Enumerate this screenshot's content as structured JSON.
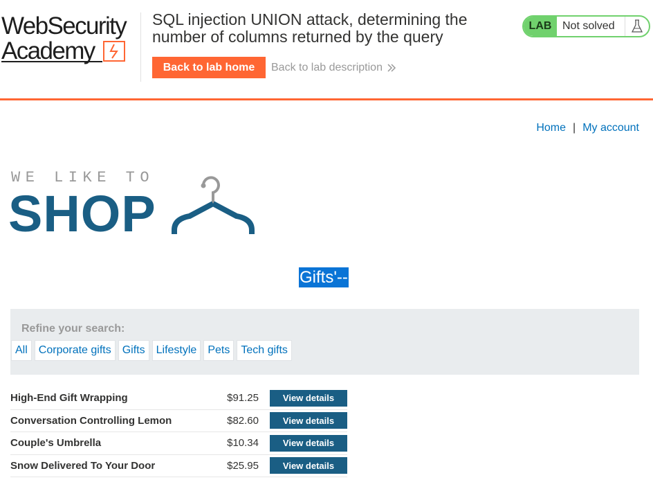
{
  "academy": {
    "logo_line1": "WebSecurity",
    "logo_line2": "Academy",
    "lab_title": "SQL injection UNION attack, determining the number of columns returned by the query",
    "back_home_label": "Back to lab home",
    "back_desc_label": "Back to lab description",
    "back_desc_icon": "double-chevron-right-icon",
    "status_badge": "LAB",
    "status_text": "Not solved",
    "status_icon": "flask-icon",
    "accent_color": "#ff6633",
    "status_color": "#70d16d"
  },
  "nav": {
    "home": "Home",
    "separator": "|",
    "account": "My account"
  },
  "shop_logo": {
    "tagline": "WE LIKE TO",
    "word": "SHOP",
    "icon": "hanger-icon",
    "brand_color": "#1a5e84"
  },
  "search_term": "Gifts'--",
  "filter": {
    "title": "Refine your search:",
    "tags": [
      "All",
      "Corporate gifts",
      "Gifts",
      "Lifestyle",
      "Pets",
      "Tech gifts"
    ]
  },
  "products": [
    {
      "name": "High-End Gift Wrapping",
      "price": "$91.25",
      "button": "View details"
    },
    {
      "name": "Conversation Controlling Lemon",
      "price": "$82.60",
      "button": "View details"
    },
    {
      "name": "Couple's Umbrella",
      "price": "$10.34",
      "button": "View details"
    },
    {
      "name": "Snow Delivered To Your Door",
      "price": "$25.95",
      "button": "View details"
    }
  ]
}
